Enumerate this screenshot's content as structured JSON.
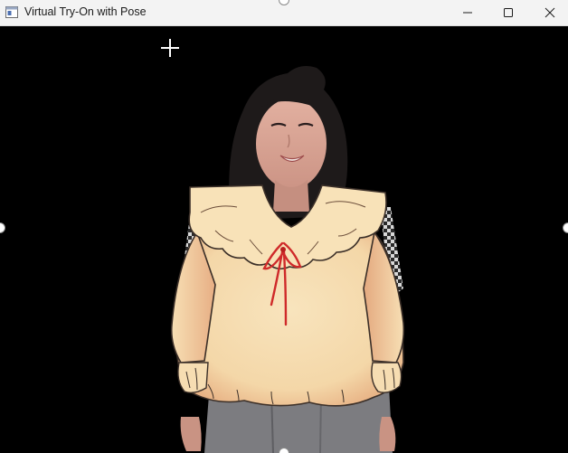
{
  "window": {
    "title": "Virtual Try-On with Pose",
    "icon": "app-window-icon",
    "controls": {
      "minimize": "minimize-icon",
      "maximize": "maximize-icon",
      "close": "close-icon"
    }
  },
  "viewport": {
    "background": "#000000",
    "cursor": "crosshair-icon",
    "content": "person wearing a virtual cream blouse with ruffled collar and red bow"
  },
  "colors": {
    "titlebar": "#f3f3f3",
    "blouse": "#f6deb0",
    "blouse_shade": "#e9b486",
    "bow": "#cf2a2a",
    "hair": "#1e1a1a",
    "skin": "#d9a596",
    "pants": "#7c7c80"
  }
}
